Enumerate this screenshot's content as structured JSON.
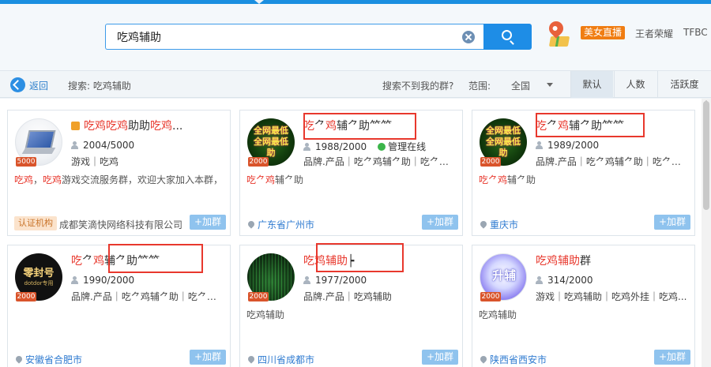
{
  "header": {
    "search_value": "吃鸡辅助",
    "live_badge": "美女直播",
    "hot_links": [
      "王者荣耀",
      "TFBC"
    ]
  },
  "toolbar": {
    "back_label": "返回",
    "search_crumb": "搜索: 吃鸡辅助",
    "not_found": "搜索不到我的群?",
    "scope_label": "范围:",
    "scope_value": "全国",
    "sort_tabs": [
      "默认",
      "人数",
      "活跃度"
    ]
  },
  "results": [
    {
      "title_parts": [
        "吃鸡吃鸡",
        "助助",
        "吃鸡",
        "..."
      ],
      "members": "2004/5000",
      "tags": "游戏｜吃鸡",
      "desc_parts": [
        "吃鸡",
        "，",
        "吃鸡",
        "游戏交流服务群，欢迎大家加入本群，"
      ],
      "level": "5000",
      "cert": "认证机构",
      "company": "成都笑滴快网络科技有限公司",
      "add": "+加群"
    },
    {
      "title_parts": [
        "吃",
        "⺈",
        "鸡",
        "辅⺈助⺮⺮"
      ],
      "members": "1988/2000",
      "online": "管理在线",
      "tags": "品牌.产品｜吃⺈鸡辅⺈助｜吃⺈鸡...",
      "desc_parts": [
        "吃⺈鸡",
        "辅⺈助"
      ],
      "level": "2000",
      "avatar_text": "全网最低 全网最低 助",
      "location": "广东省广州市",
      "add": "+加群"
    },
    {
      "title_parts": [
        "吃",
        "⺈",
        "鸡",
        "辅⺈助⺮⺮"
      ],
      "members": "1989/2000",
      "tags": "品牌.产品｜吃⺈鸡辅⺈助｜吃⺈鸡...",
      "desc_parts": [
        "吃⺈鸡",
        "辅⺈助"
      ],
      "level": "2000",
      "avatar_text": "全网最低 全网最低 助",
      "location": "重庆市",
      "add": "+加群"
    },
    {
      "title_parts": [
        "吃",
        "⺈",
        "鸡",
        "辅⺈助⺮⺮"
      ],
      "members": "1990/2000",
      "tags": "品牌.产品｜吃⺈鸡辅⺈助｜吃⺈鸡...",
      "level": "2000",
      "avatar_title": "零封号",
      "avatar_sub": "dotdor专用",
      "location": "安徽省合肥市",
      "add": "+加群"
    },
    {
      "title_parts": [
        "吃鸡辅助",
        "┝"
      ],
      "members": "1977/2000",
      "tags": "品牌.产品｜吃鸡辅助",
      "desc": "吃鸡辅助",
      "level": "2000",
      "location": "四川省成都市",
      "add": "+加群"
    },
    {
      "title_parts": [
        "吃鸡辅助",
        "群"
      ],
      "members": "314/2000",
      "tags": "游戏｜吃鸡辅助｜吃鸡外挂｜吃鸡...",
      "desc": "吃鸡辅助",
      "level": "2000",
      "avatar_text": "升辅",
      "location": "陕西省西安市",
      "add": "+加群"
    }
  ]
}
